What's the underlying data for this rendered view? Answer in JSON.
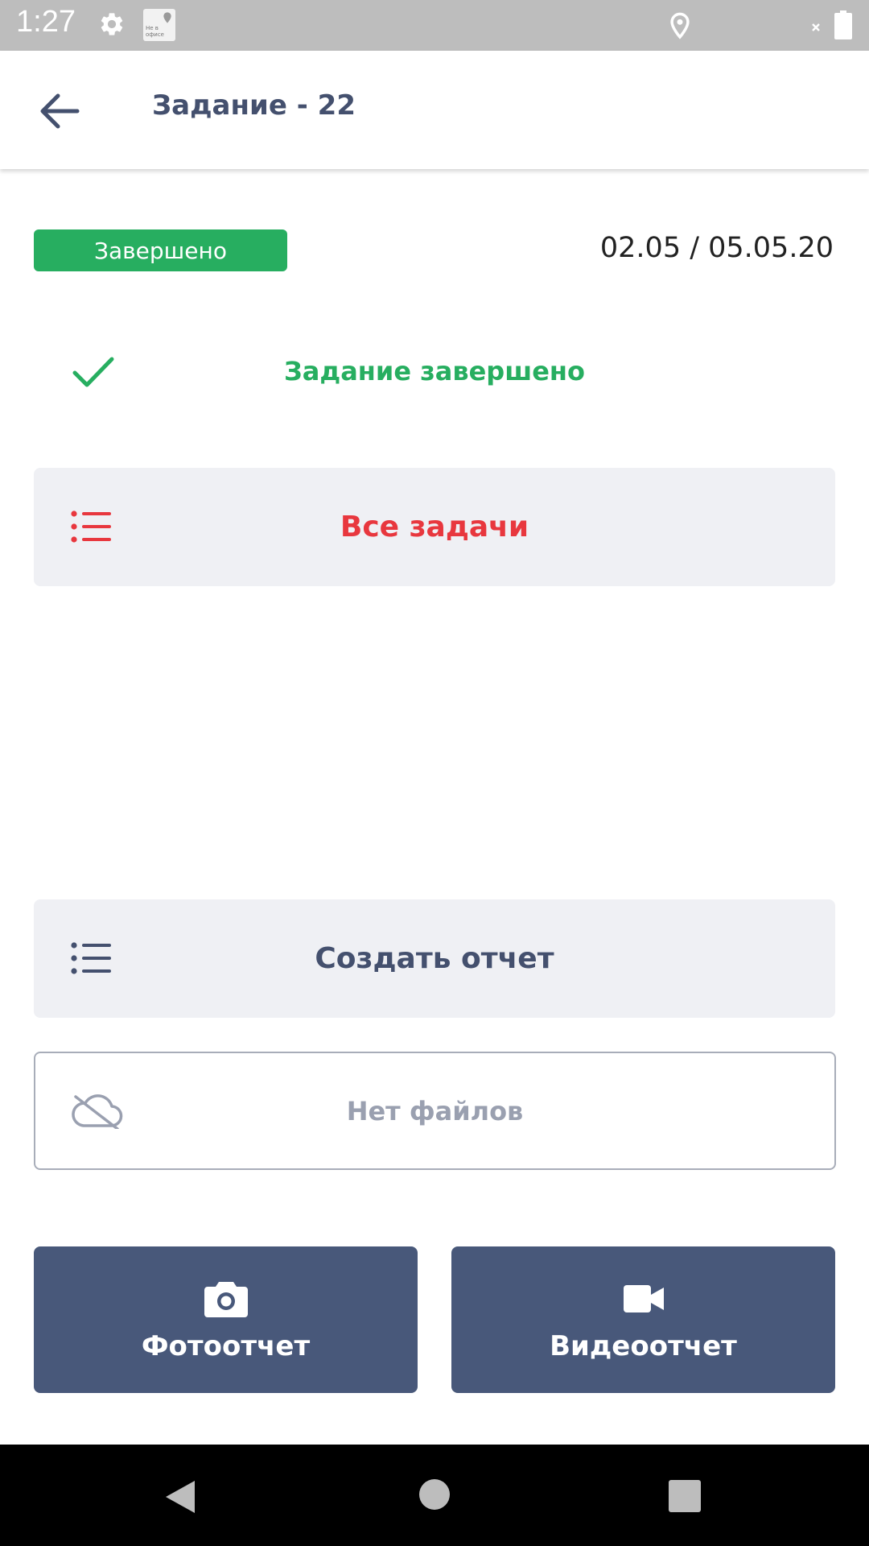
{
  "status_bar": {
    "time": "1:27",
    "app_icon_line1": "Не в",
    "app_icon_line2": "офисе",
    "icons": [
      "gear-icon",
      "app-notification-icon",
      "location-icon",
      "no-signal-icon",
      "battery-icon"
    ]
  },
  "header": {
    "back_icon": "arrow-left-icon",
    "title": "Задание - 22"
  },
  "task": {
    "status_badge": "Завершено",
    "status_color": "#27ae60",
    "date_range": "02.05 / 05.05.20",
    "completion_icon": "check-icon",
    "completion_text": "Задание завершено"
  },
  "actions": {
    "all_tasks_label": "Все задачи",
    "all_tasks_color": "#e8373e",
    "create_report_label": "Создать отчет",
    "files_label": "Нет файлов",
    "files_icon": "cloud-off-icon",
    "photo_report_label": "Фотоотчет",
    "photo_icon": "camera-icon",
    "video_report_label": "Видеоотчет",
    "video_icon": "video-camera-icon",
    "button_color": "#48587a"
  },
  "nav_bar": {
    "icons": [
      "nav-back-icon",
      "nav-home-icon",
      "nav-recents-icon"
    ]
  }
}
